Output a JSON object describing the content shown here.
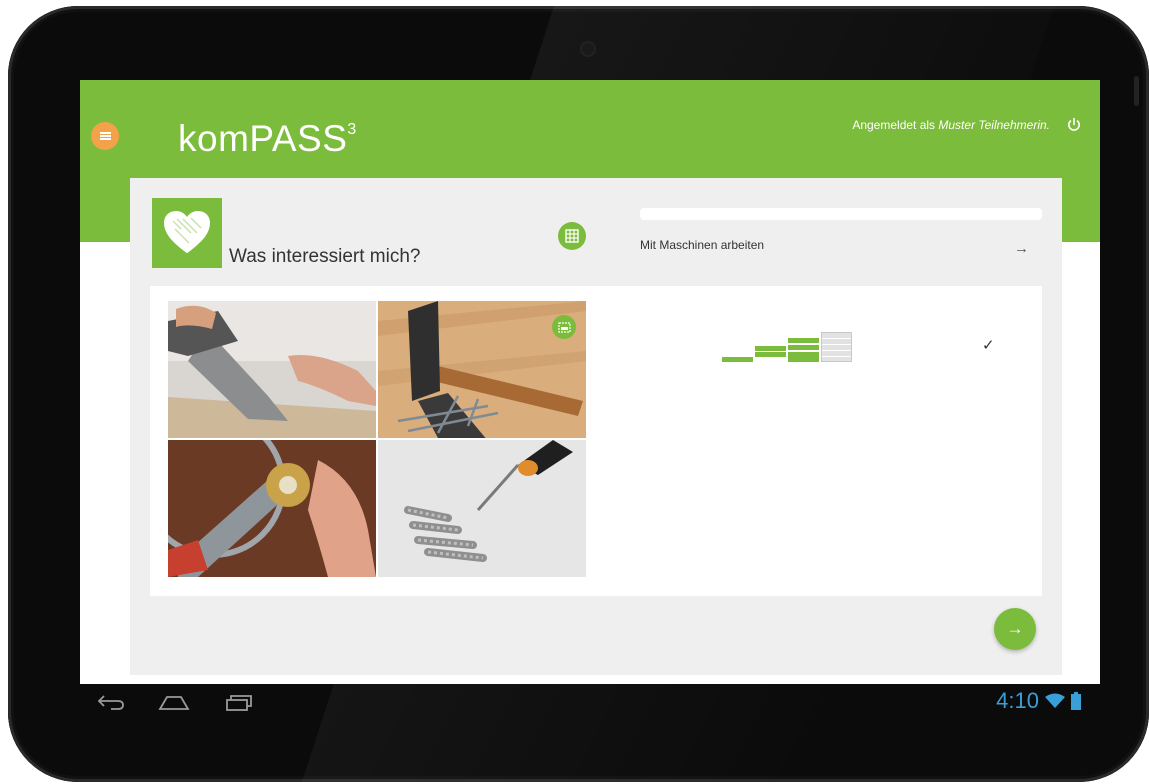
{
  "app": {
    "logo": "komPASS",
    "logo_superscript": "3",
    "user_prefix": "Angemeldet als ",
    "user_name": "Muster Teilnehmerin.",
    "brand_color": "#7cbc3c",
    "menu_color": "#f3a24a"
  },
  "card": {
    "title": "Was interessiert mich?",
    "category": "Mit Maschinen arbeiten",
    "progress": 0.0
  },
  "images": [
    {
      "icon": "saw-photo"
    },
    {
      "icon": "hammer-nails-photo"
    },
    {
      "icon": "wrench-photo"
    },
    {
      "icon": "screwdriver-dowels-photo"
    }
  ],
  "rating": {
    "levels": 4,
    "filled": 3
  },
  "icons": {
    "menu": "menu-icon",
    "power": "power-icon",
    "heart": "heart-icon",
    "grid": "grid-icon",
    "arrow": "arrow-right-icon",
    "check": "check-icon",
    "photo": "image-icon",
    "back": "back-icon",
    "home": "home-icon",
    "recents": "recents-icon",
    "wifi": "wifi-icon",
    "battery": "battery-icon"
  },
  "status_bar": {
    "time": "4:10"
  }
}
